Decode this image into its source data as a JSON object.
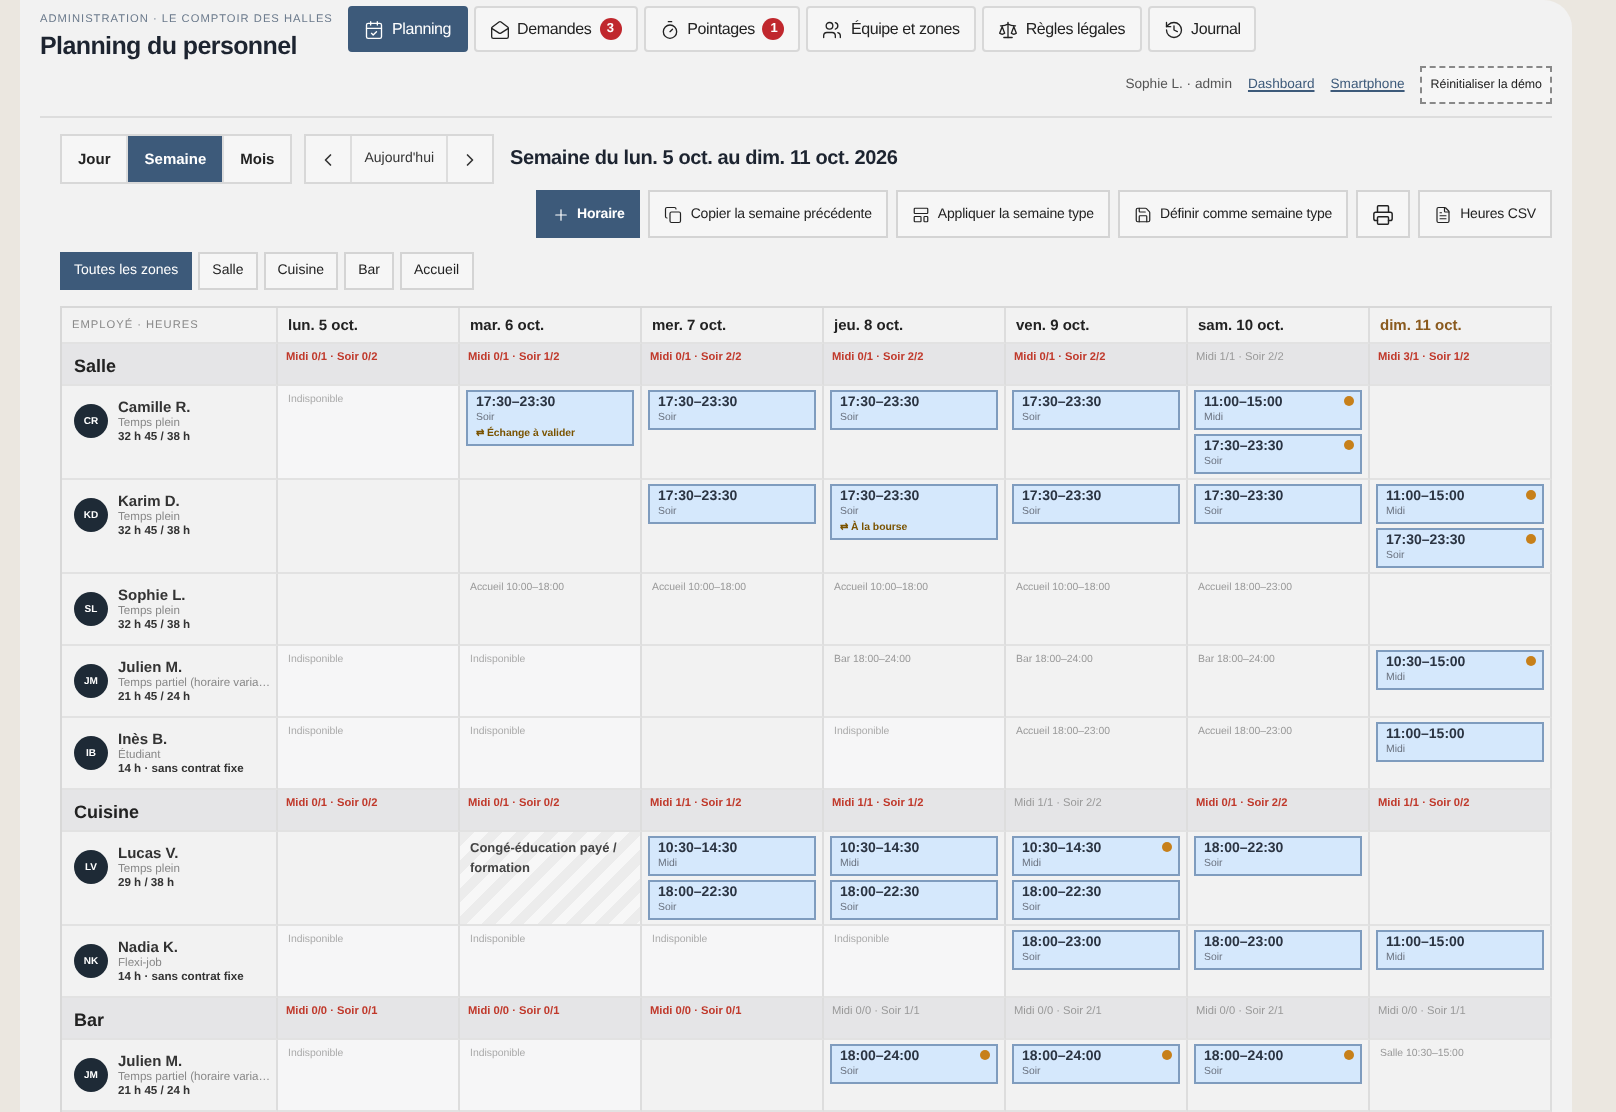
{
  "header": {
    "breadcrumb": "ADMINISTRATION · LE COMPTOIR DES HALLES",
    "title": "Planning du personnel",
    "tabs": [
      {
        "label": "Planning",
        "selected": true
      },
      {
        "label": "Demandes",
        "badge": "3",
        "selected": false
      },
      {
        "label": "Pointages",
        "badge": "1",
        "selected": false
      },
      {
        "label": "Équipe et zones",
        "selected": false
      },
      {
        "label": "Règles légales",
        "selected": false
      },
      {
        "label": "Journal",
        "selected": false
      }
    ],
    "user": "Sophie L. · admin",
    "links": [
      "Dashboard",
      "Smartphone"
    ],
    "reset": "Réinitialiser la démo"
  },
  "toolbar": {
    "views": [
      {
        "label": "Jour",
        "selected": false
      },
      {
        "label": "Semaine",
        "selected": true
      },
      {
        "label": "Mois",
        "selected": false
      }
    ],
    "today": "Aujourd'hui",
    "week": "Semaine du lun. 5 oct. au dim. 11 oct. 2026",
    "actions": [
      {
        "kind": "primary",
        "label": "Horaire"
      },
      {
        "kind": "copy",
        "label": "Copier la semaine précédente"
      },
      {
        "kind": "template",
        "label": "Appliquer la semaine type"
      },
      {
        "kind": "save",
        "label": "Définir comme semaine type"
      },
      {
        "kind": "print"
      },
      {
        "kind": "csv",
        "label": "Heures CSV"
      }
    ]
  },
  "zones": [
    {
      "label": "Toutes les zones",
      "selected": true
    },
    {
      "label": "Salle",
      "selected": false
    },
    {
      "label": "Cuisine",
      "selected": false
    },
    {
      "label": "Bar",
      "selected": false
    },
    {
      "label": "Accueil",
      "selected": false
    }
  ],
  "table": {
    "employee_header": "EMPLOYÉ · HEURES",
    "days": [
      {
        "label": "lun. 5 oct.",
        "today": false
      },
      {
        "label": "mar. 6 oct.",
        "today": false
      },
      {
        "label": "mer. 7 oct.",
        "today": false
      },
      {
        "label": "jeu. 8 oct.",
        "today": false
      },
      {
        "label": "ven. 9 oct.",
        "today": false
      },
      {
        "label": "sam. 10 oct.",
        "today": false
      },
      {
        "label": "dim. 11 oct.",
        "today": true
      }
    ],
    "groups": [
      {
        "name": "Salle",
        "coverage": [
          {
            "text": "Midi 0/1 · Soir 0/2",
            "alert": true
          },
          {
            "text": "Midi 0/1 · Soir 1/2",
            "alert": true
          },
          {
            "text": "Midi 0/1 · Soir 2/2",
            "alert": true
          },
          {
            "text": "Midi 0/1 · Soir 2/2",
            "alert": true
          },
          {
            "text": "Midi 0/1 · Soir 2/2",
            "alert": true
          },
          {
            "text": "Midi 1/1 · Soir 2/2",
            "alert": false
          },
          {
            "text": "Midi 3/1 · Soir 1/2",
            "alert": true
          }
        ],
        "rows": [
          {
            "initials": "CR",
            "name": "Camille R.",
            "contract": "Temps plein",
            "hours": "32 h 45 / 38 h",
            "cells": [
              {
                "kind": "off",
                "text": "Indisponible"
              },
              {
                "kind": "shifts",
                "shifts": [
                  {
                    "time": "17:30–23:30",
                    "label": "Soir",
                    "extra": "⇄ Échange à valider",
                    "flagged": false
                  }
                ]
              },
              {
                "kind": "shifts",
                "shifts": [
                  {
                    "time": "17:30–23:30",
                    "label": "Soir",
                    "flagged": false
                  }
                ]
              },
              {
                "kind": "shifts",
                "shifts": [
                  {
                    "time": "17:30–23:30",
                    "label": "Soir",
                    "flagged": false
                  }
                ]
              },
              {
                "kind": "shifts",
                "shifts": [
                  {
                    "time": "17:30–23:30",
                    "label": "Soir",
                    "flagged": false
                  }
                ]
              },
              {
                "kind": "shifts",
                "shifts": [
                  {
                    "time": "11:00–15:00",
                    "label": "Midi",
                    "flagged": true
                  },
                  {
                    "time": "17:30–23:30",
                    "label": "Soir",
                    "flagged": true
                  }
                ]
              },
              {
                "kind": "empty"
              }
            ]
          },
          {
            "initials": "KD",
            "name": "Karim D.",
            "contract": "Temps plein",
            "hours": "32 h 45 / 38 h",
            "cells": [
              {
                "kind": "empty"
              },
              {
                "kind": "empty"
              },
              {
                "kind": "shifts",
                "shifts": [
                  {
                    "time": "17:30–23:30",
                    "label": "Soir",
                    "flagged": false
                  }
                ]
              },
              {
                "kind": "shifts",
                "shifts": [
                  {
                    "time": "17:30–23:30",
                    "label": "Soir",
                    "extra": "⇄ À la bourse",
                    "flagged": false
                  }
                ]
              },
              {
                "kind": "shifts",
                "shifts": [
                  {
                    "time": "17:30–23:30",
                    "label": "Soir",
                    "flagged": false
                  }
                ]
              },
              {
                "kind": "shifts",
                "shifts": [
                  {
                    "time": "17:30–23:30",
                    "label": "Soir",
                    "flagged": false
                  }
                ]
              },
              {
                "kind": "shifts",
                "shifts": [
                  {
                    "time": "11:00–15:00",
                    "label": "Midi",
                    "flagged": true
                  },
                  {
                    "time": "17:30–23:30",
                    "label": "Soir",
                    "flagged": true
                  }
                ]
              }
            ]
          },
          {
            "initials": "SL",
            "name": "Sophie L.",
            "contract": "Temps plein",
            "hours": "32 h 45 / 38 h",
            "cells": [
              {
                "kind": "empty"
              },
              {
                "kind": "note",
                "text": "Accueil 10:00–18:00"
              },
              {
                "kind": "note",
                "text": "Accueil 10:00–18:00"
              },
              {
                "kind": "note",
                "text": "Accueil 10:00–18:00"
              },
              {
                "kind": "note",
                "text": "Accueil 10:00–18:00"
              },
              {
                "kind": "note",
                "text": "Accueil 18:00–23:00"
              },
              {
                "kind": "empty"
              }
            ]
          },
          {
            "initials": "JM",
            "name": "Julien M.",
            "contract": "Temps partiel (horaire varia…",
            "hours": "21 h 45 / 24 h",
            "cells": [
              {
                "kind": "off",
                "text": "Indisponible"
              },
              {
                "kind": "off",
                "text": "Indisponible"
              },
              {
                "kind": "empty"
              },
              {
                "kind": "note",
                "text": "Bar 18:00–24:00"
              },
              {
                "kind": "note",
                "text": "Bar 18:00–24:00"
              },
              {
                "kind": "note",
                "text": "Bar 18:00–24:00"
              },
              {
                "kind": "shifts",
                "shifts": [
                  {
                    "time": "10:30–15:00",
                    "label": "Midi",
                    "flagged": true
                  }
                ]
              }
            ]
          },
          {
            "initials": "IB",
            "name": "Inès B.",
            "contract": "Étudiant",
            "hours": "14 h · sans contrat fixe",
            "cells": [
              {
                "kind": "off",
                "text": "Indisponible"
              },
              {
                "kind": "off",
                "text": "Indisponible"
              },
              {
                "kind": "empty"
              },
              {
                "kind": "off",
                "text": "Indisponible"
              },
              {
                "kind": "note",
                "text": "Accueil 18:00–23:00"
              },
              {
                "kind": "note",
                "text": "Accueil 18:00–23:00"
              },
              {
                "kind": "shifts",
                "shifts": [
                  {
                    "time": "11:00–15:00",
                    "label": "Midi",
                    "flagged": false
                  }
                ]
              }
            ]
          }
        ]
      },
      {
        "name": "Cuisine",
        "coverage": [
          {
            "text": "Midi 0/1 · Soir 0/2",
            "alert": true
          },
          {
            "text": "Midi 0/1 · Soir 0/2",
            "alert": true
          },
          {
            "text": "Midi 1/1 · Soir 1/2",
            "alert": true
          },
          {
            "text": "Midi 1/1 · Soir 1/2",
            "alert": true
          },
          {
            "text": "Midi 1/1 · Soir 2/2",
            "alert": false
          },
          {
            "text": "Midi 0/1 · Soir 2/2",
            "alert": true
          },
          {
            "text": "Midi 1/1 · Soir 0/2",
            "alert": true
          }
        ],
        "rows": [
          {
            "initials": "LV",
            "name": "Lucas V.",
            "contract": "Temps plein",
            "hours": "29 h / 38 h",
            "cells": [
              {
                "kind": "empty"
              },
              {
                "kind": "leave",
                "text": "Congé-éducation payé / formation"
              },
              {
                "kind": "shifts",
                "shifts": [
                  {
                    "time": "10:30–14:30",
                    "label": "Midi",
                    "flagged": false
                  },
                  {
                    "time": "18:00–22:30",
                    "label": "Soir",
                    "flagged": false
                  }
                ]
              },
              {
                "kind": "shifts",
                "shifts": [
                  {
                    "time": "10:30–14:30",
                    "label": "Midi",
                    "flagged": false
                  },
                  {
                    "time": "18:00–22:30",
                    "label": "Soir",
                    "flagged": false
                  }
                ]
              },
              {
                "kind": "shifts",
                "shifts": [
                  {
                    "time": "10:30–14:30",
                    "label": "Midi",
                    "flagged": true
                  },
                  {
                    "time": "18:00–22:30",
                    "label": "Soir",
                    "flagged": false
                  }
                ]
              },
              {
                "kind": "shifts",
                "shifts": [
                  {
                    "time": "18:00–22:30",
                    "label": "Soir",
                    "flagged": false
                  }
                ]
              },
              {
                "kind": "empty"
              }
            ]
          },
          {
            "initials": "NK",
            "name": "Nadia K.",
            "contract": "Flexi-job",
            "hours": "14 h · sans contrat fixe",
            "cells": [
              {
                "kind": "off",
                "text": "Indisponible"
              },
              {
                "kind": "off",
                "text": "Indisponible"
              },
              {
                "kind": "off",
                "text": "Indisponible"
              },
              {
                "kind": "off",
                "text": "Indisponible"
              },
              {
                "kind": "shifts",
                "shifts": [
                  {
                    "time": "18:00–23:00",
                    "label": "Soir",
                    "flagged": false
                  }
                ]
              },
              {
                "kind": "shifts",
                "shifts": [
                  {
                    "time": "18:00–23:00",
                    "label": "Soir",
                    "flagged": false
                  }
                ]
              },
              {
                "kind": "shifts",
                "shifts": [
                  {
                    "time": "11:00–15:00",
                    "label": "Midi",
                    "flagged": false
                  }
                ]
              }
            ]
          }
        ]
      },
      {
        "name": "Bar",
        "coverage": [
          {
            "text": "Midi 0/0 · Soir 0/1",
            "alert": true
          },
          {
            "text": "Midi 0/0 · Soir 0/1",
            "alert": true
          },
          {
            "text": "Midi 0/0 · Soir 0/1",
            "alert": true
          },
          {
            "text": "Midi 0/0 · Soir 1/1",
            "alert": false
          },
          {
            "text": "Midi 0/0 · Soir 2/1",
            "alert": false
          },
          {
            "text": "Midi 0/0 · Soir 2/1",
            "alert": false
          },
          {
            "text": "Midi 0/0 · Soir 1/1",
            "alert": false
          }
        ],
        "rows": [
          {
            "initials": "JM",
            "name": "Julien M.",
            "contract": "Temps partiel (horaire varia…",
            "hours": "21 h 45 / 24 h",
            "cells": [
              {
                "kind": "off",
                "text": "Indisponible"
              },
              {
                "kind": "off",
                "text": "Indisponible"
              },
              {
                "kind": "empty"
              },
              {
                "kind": "shifts",
                "shifts": [
                  {
                    "time": "18:00–24:00",
                    "label": "Soir",
                    "flagged": true
                  }
                ]
              },
              {
                "kind": "shifts",
                "shifts": [
                  {
                    "time": "18:00–24:00",
                    "label": "Soir",
                    "flagged": true
                  }
                ]
              },
              {
                "kind": "shifts",
                "shifts": [
                  {
                    "time": "18:00–24:00",
                    "label": "Soir",
                    "flagged": true
                  }
                ]
              },
              {
                "kind": "note",
                "text": "Salle 10:30–15:00"
              }
            ]
          }
        ]
      }
    ]
  }
}
